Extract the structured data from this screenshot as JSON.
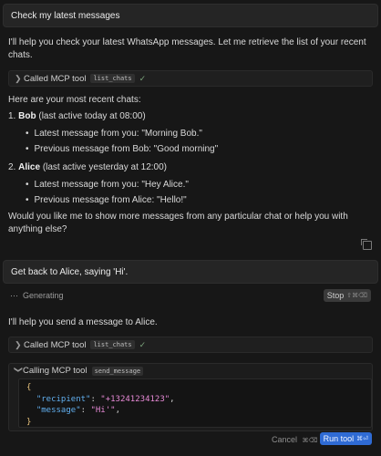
{
  "messages": {
    "user1": "Check my latest messages",
    "assistant_intro": "I'll help you check your latest WhatsApp messages. Let me retrieve the list of your recent chats.",
    "tool_call_1": {
      "label": "Called MCP tool",
      "tool": "list_chats"
    },
    "recent_header": "Here are your most recent chats:",
    "chats": [
      {
        "num": "1.",
        "name": "Bob",
        "meta": "(last active today at 08:00)",
        "bullets": [
          "Latest message from you: \"Morning Bob.\"",
          "Previous message from Bob: \"Good morning\""
        ]
      },
      {
        "num": "2.",
        "name": "Alice",
        "meta": "(last active yesterday at 12:00)",
        "bullets": [
          "Latest message from you: \"Hey Alice.\"",
          "Previous message from Alice: \"Hello!\""
        ]
      }
    ],
    "followup": "Would you like me to show more messages from any particular chat or help you with anything else?",
    "user2": "Get back to Alice, saying 'Hi'.",
    "generating": "Generating",
    "stop_label": "Stop",
    "stop_shortcut": "⇧⌘⌫",
    "assistant_reply": "I'll help you send a message to Alice.",
    "tool_call_2": {
      "label": "Called MCP tool",
      "tool": "list_chats"
    },
    "tool_call_3": {
      "label": "Calling MCP tool",
      "tool": "send_message"
    },
    "code": {
      "open": "{",
      "recipient_key": "\"recipient\"",
      "recipient_val": "\"+13241234123\"",
      "message_key": "\"message\"",
      "message_val": "\"Hi'\"",
      "close": "}"
    },
    "cancel_label": "Cancel",
    "cancel_shortcut": "⌘⌫",
    "run_label": "Run tool",
    "run_shortcut": "⌘⏎"
  }
}
